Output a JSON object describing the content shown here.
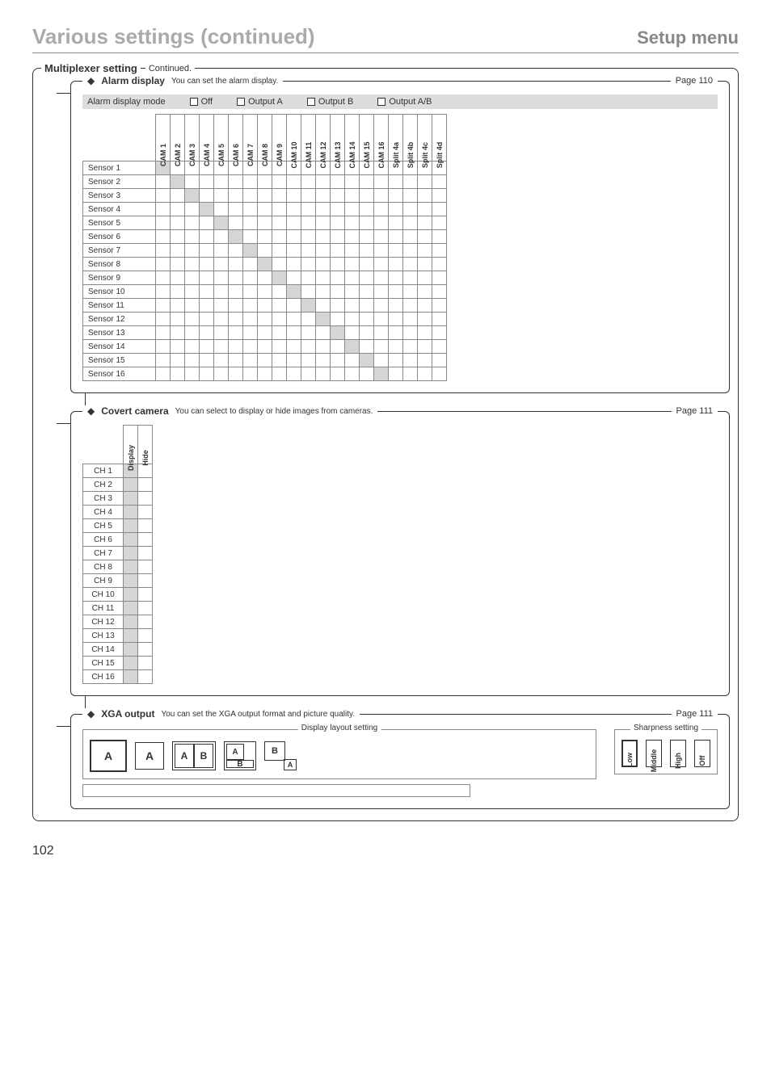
{
  "header": {
    "main_title": "Various settings (continued)",
    "right_title": "Setup menu"
  },
  "outer": {
    "title": "Multiplexer setting",
    "note": "Continued."
  },
  "alarm": {
    "title": "Alarm display",
    "desc": "You can set the alarm display.",
    "page_ref": "Page 110",
    "mode_label": "Alarm display mode",
    "options": {
      "off": "Off",
      "output_a": "Output A",
      "output_b": "Output B",
      "output_ab": "Output A/B"
    },
    "cols": [
      "CAM 1",
      "CAM 2",
      "CAM 3",
      "CAM 4",
      "CAM 5",
      "CAM 6",
      "CAM 7",
      "CAM 8",
      "CAM 9",
      "CAM 10",
      "CAM 11",
      "CAM 12",
      "CAM 13",
      "CAM 14",
      "CAM 15",
      "CAM 16",
      "Split 4a",
      "Split 4b",
      "Split 4c",
      "Split 4d"
    ],
    "rows": [
      "Sensor 1",
      "Sensor 2",
      "Sensor 3",
      "Sensor 4",
      "Sensor 5",
      "Sensor 6",
      "Sensor 7",
      "Sensor 8",
      "Sensor 9",
      "Sensor 10",
      "Sensor 11",
      "Sensor 12",
      "Sensor 13",
      "Sensor 14",
      "Sensor 15",
      "Sensor 16"
    ]
  },
  "covert": {
    "title": "Covert camera",
    "desc": "You can select to display or hide images from cameras.",
    "page_ref": "Page 111",
    "cols": [
      "Display",
      "Hide"
    ],
    "rows": [
      "CH 1",
      "CH 2",
      "CH 3",
      "CH 4",
      "CH 5",
      "CH 6",
      "CH 7",
      "CH 8",
      "CH 9",
      "CH 10",
      "CH 11",
      "CH 12",
      "CH 13",
      "CH 14",
      "CH 15",
      "CH 16"
    ]
  },
  "xga": {
    "title": "XGA output",
    "desc": "You can set the XGA output format and picture quality.",
    "page_ref": "Page 111",
    "layout_group": "Display layout setting",
    "sharp_group": "Sharpness setting",
    "labels": {
      "a": "A",
      "b": "B"
    },
    "sharp": [
      "Low",
      "Middle",
      "High",
      "Off"
    ]
  },
  "pagenum": "102"
}
